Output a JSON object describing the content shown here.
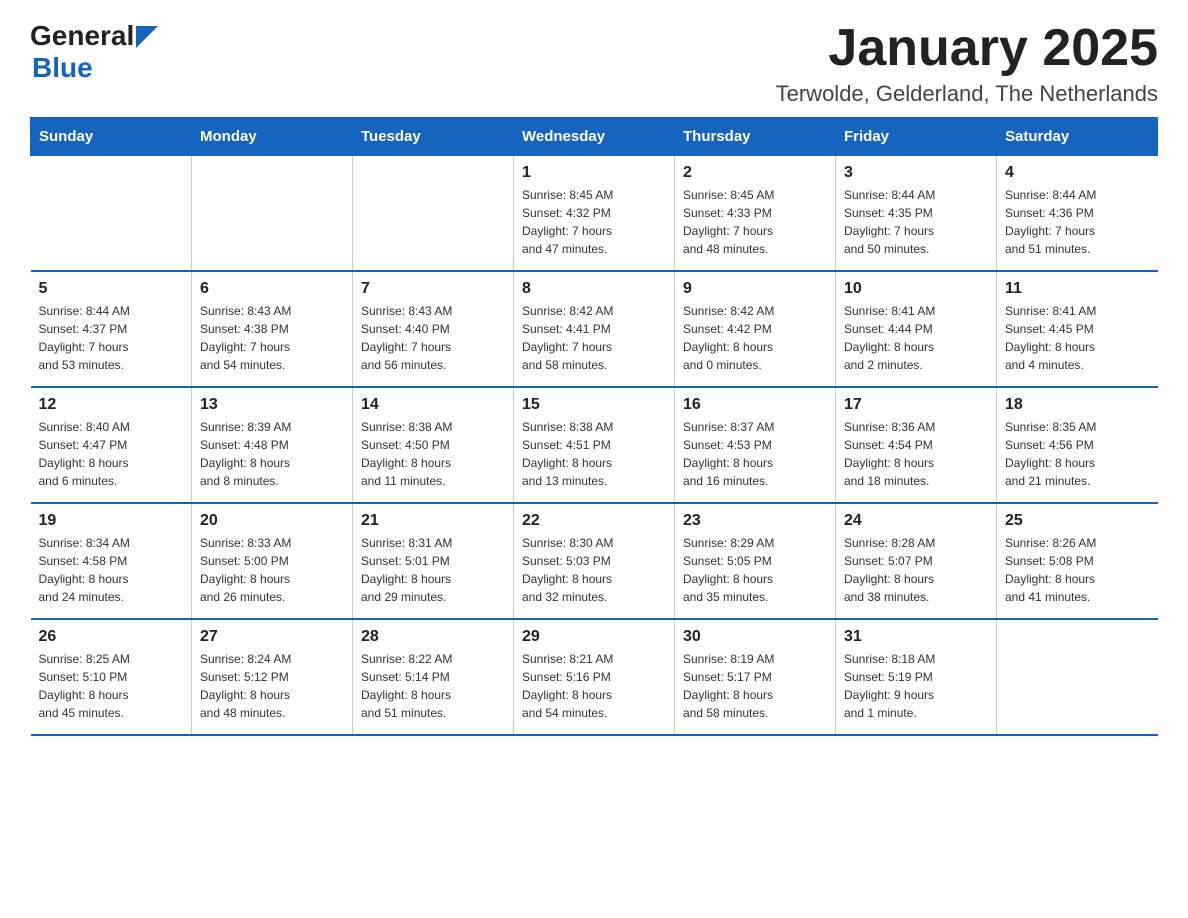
{
  "header": {
    "logo_general": "General",
    "logo_blue": "Blue",
    "month_title": "January 2025",
    "location": "Terwolde, Gelderland, The Netherlands"
  },
  "weekdays": [
    "Sunday",
    "Monday",
    "Tuesday",
    "Wednesday",
    "Thursday",
    "Friday",
    "Saturday"
  ],
  "weeks": [
    [
      {
        "day": "",
        "info": ""
      },
      {
        "day": "",
        "info": ""
      },
      {
        "day": "",
        "info": ""
      },
      {
        "day": "1",
        "info": "Sunrise: 8:45 AM\nSunset: 4:32 PM\nDaylight: 7 hours\nand 47 minutes."
      },
      {
        "day": "2",
        "info": "Sunrise: 8:45 AM\nSunset: 4:33 PM\nDaylight: 7 hours\nand 48 minutes."
      },
      {
        "day": "3",
        "info": "Sunrise: 8:44 AM\nSunset: 4:35 PM\nDaylight: 7 hours\nand 50 minutes."
      },
      {
        "day": "4",
        "info": "Sunrise: 8:44 AM\nSunset: 4:36 PM\nDaylight: 7 hours\nand 51 minutes."
      }
    ],
    [
      {
        "day": "5",
        "info": "Sunrise: 8:44 AM\nSunset: 4:37 PM\nDaylight: 7 hours\nand 53 minutes."
      },
      {
        "day": "6",
        "info": "Sunrise: 8:43 AM\nSunset: 4:38 PM\nDaylight: 7 hours\nand 54 minutes."
      },
      {
        "day": "7",
        "info": "Sunrise: 8:43 AM\nSunset: 4:40 PM\nDaylight: 7 hours\nand 56 minutes."
      },
      {
        "day": "8",
        "info": "Sunrise: 8:42 AM\nSunset: 4:41 PM\nDaylight: 7 hours\nand 58 minutes."
      },
      {
        "day": "9",
        "info": "Sunrise: 8:42 AM\nSunset: 4:42 PM\nDaylight: 8 hours\nand 0 minutes."
      },
      {
        "day": "10",
        "info": "Sunrise: 8:41 AM\nSunset: 4:44 PM\nDaylight: 8 hours\nand 2 minutes."
      },
      {
        "day": "11",
        "info": "Sunrise: 8:41 AM\nSunset: 4:45 PM\nDaylight: 8 hours\nand 4 minutes."
      }
    ],
    [
      {
        "day": "12",
        "info": "Sunrise: 8:40 AM\nSunset: 4:47 PM\nDaylight: 8 hours\nand 6 minutes."
      },
      {
        "day": "13",
        "info": "Sunrise: 8:39 AM\nSunset: 4:48 PM\nDaylight: 8 hours\nand 8 minutes."
      },
      {
        "day": "14",
        "info": "Sunrise: 8:38 AM\nSunset: 4:50 PM\nDaylight: 8 hours\nand 11 minutes."
      },
      {
        "day": "15",
        "info": "Sunrise: 8:38 AM\nSunset: 4:51 PM\nDaylight: 8 hours\nand 13 minutes."
      },
      {
        "day": "16",
        "info": "Sunrise: 8:37 AM\nSunset: 4:53 PM\nDaylight: 8 hours\nand 16 minutes."
      },
      {
        "day": "17",
        "info": "Sunrise: 8:36 AM\nSunset: 4:54 PM\nDaylight: 8 hours\nand 18 minutes."
      },
      {
        "day": "18",
        "info": "Sunrise: 8:35 AM\nSunset: 4:56 PM\nDaylight: 8 hours\nand 21 minutes."
      }
    ],
    [
      {
        "day": "19",
        "info": "Sunrise: 8:34 AM\nSunset: 4:58 PM\nDaylight: 8 hours\nand 24 minutes."
      },
      {
        "day": "20",
        "info": "Sunrise: 8:33 AM\nSunset: 5:00 PM\nDaylight: 8 hours\nand 26 minutes."
      },
      {
        "day": "21",
        "info": "Sunrise: 8:31 AM\nSunset: 5:01 PM\nDaylight: 8 hours\nand 29 minutes."
      },
      {
        "day": "22",
        "info": "Sunrise: 8:30 AM\nSunset: 5:03 PM\nDaylight: 8 hours\nand 32 minutes."
      },
      {
        "day": "23",
        "info": "Sunrise: 8:29 AM\nSunset: 5:05 PM\nDaylight: 8 hours\nand 35 minutes."
      },
      {
        "day": "24",
        "info": "Sunrise: 8:28 AM\nSunset: 5:07 PM\nDaylight: 8 hours\nand 38 minutes."
      },
      {
        "day": "25",
        "info": "Sunrise: 8:26 AM\nSunset: 5:08 PM\nDaylight: 8 hours\nand 41 minutes."
      }
    ],
    [
      {
        "day": "26",
        "info": "Sunrise: 8:25 AM\nSunset: 5:10 PM\nDaylight: 8 hours\nand 45 minutes."
      },
      {
        "day": "27",
        "info": "Sunrise: 8:24 AM\nSunset: 5:12 PM\nDaylight: 8 hours\nand 48 minutes."
      },
      {
        "day": "28",
        "info": "Sunrise: 8:22 AM\nSunset: 5:14 PM\nDaylight: 8 hours\nand 51 minutes."
      },
      {
        "day": "29",
        "info": "Sunrise: 8:21 AM\nSunset: 5:16 PM\nDaylight: 8 hours\nand 54 minutes."
      },
      {
        "day": "30",
        "info": "Sunrise: 8:19 AM\nSunset: 5:17 PM\nDaylight: 8 hours\nand 58 minutes."
      },
      {
        "day": "31",
        "info": "Sunrise: 8:18 AM\nSunset: 5:19 PM\nDaylight: 9 hours\nand 1 minute."
      },
      {
        "day": "",
        "info": ""
      }
    ]
  ]
}
